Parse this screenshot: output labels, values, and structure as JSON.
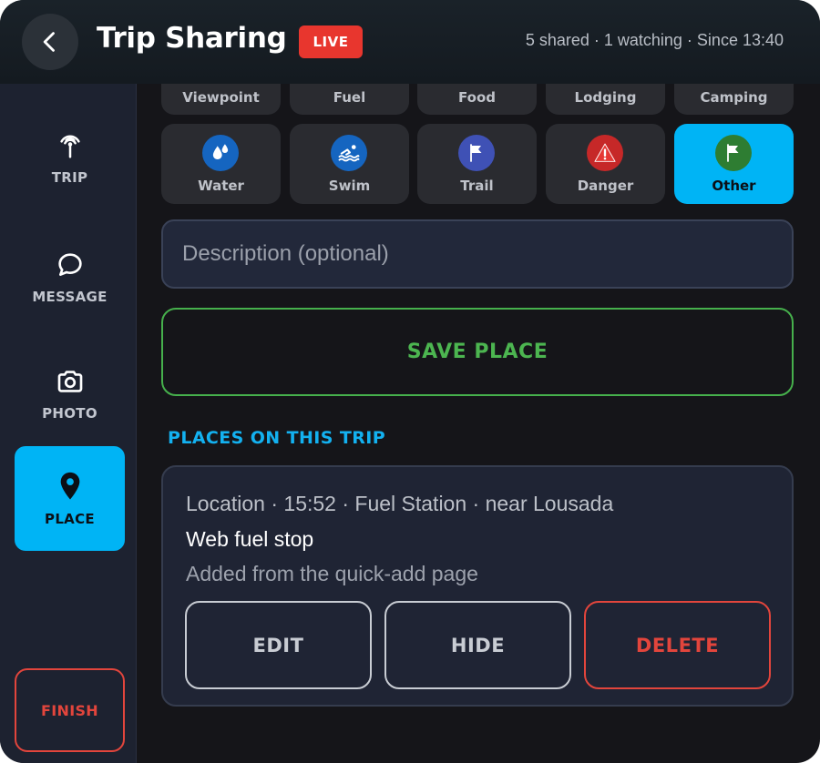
{
  "header": {
    "title": "Trip Sharing",
    "live_badge": "LIVE",
    "status": "5 shared · 1 watching · Since 13:40",
    "back_icon": "chevron-left-icon"
  },
  "sidebar": {
    "items": [
      {
        "label": "TRIP",
        "icon": "broadcast-icon",
        "active": false
      },
      {
        "label": "MESSAGE",
        "icon": "chat-bubble-icon",
        "active": false
      },
      {
        "label": "PHOTO",
        "icon": "camera-icon",
        "active": false
      },
      {
        "label": "PLACE",
        "icon": "map-pin-icon",
        "active": true
      }
    ],
    "finish_label": "FINISH"
  },
  "categories": {
    "top_row": [
      "Viewpoint",
      "Fuel",
      "Food",
      "Lodging",
      "Camping"
    ],
    "bottom_row": [
      {
        "label": "Water",
        "icon": "water-drops-icon",
        "color": "#1565c0"
      },
      {
        "label": "Swim",
        "icon": "swimmer-icon",
        "color": "#1565c0"
      },
      {
        "label": "Trail",
        "icon": "flag-icon",
        "color": "#3f51b5"
      },
      {
        "label": "Danger",
        "icon": "warning-icon",
        "color": "#c62828"
      },
      {
        "label": "Other",
        "icon": "flag-icon",
        "color": "#2e7d32"
      }
    ],
    "selected": "Other"
  },
  "description": {
    "placeholder": "Description (optional)",
    "value": ""
  },
  "save_label": "SAVE PLACE",
  "places": {
    "section_title": "PLACES ON THIS TRIP",
    "items": [
      {
        "meta": "Location · 15:52 · Fuel Station · near Lousada",
        "name": "Web fuel stop",
        "note": "Added from the quick-add page",
        "edit_label": "EDIT",
        "hide_label": "HIDE",
        "delete_label": "DELETE"
      }
    ]
  },
  "colors": {
    "accent": "#00b4f5",
    "success": "#4cb550",
    "danger": "#e2453c",
    "live": "#e8362e"
  }
}
